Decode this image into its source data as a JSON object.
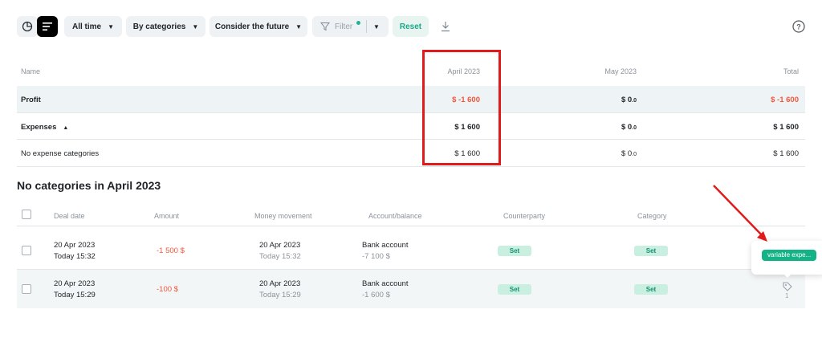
{
  "toolbar": {
    "period": "All time",
    "grouping": "By categories",
    "future": "Consider the future",
    "filter": "Filter",
    "reset": "Reset"
  },
  "summary": {
    "headers": {
      "name": "Name",
      "april": "April 2023",
      "may": "May 2023",
      "total": "Total"
    },
    "profit": {
      "label": "Profit",
      "april": "$ -1 600",
      "may_main": "$ 0",
      "may_dec": ".0",
      "total": "$ -1 600"
    },
    "expenses": {
      "label": "Expenses",
      "april": "$ 1 600",
      "may_main": "$ 0",
      "may_dec": ".0",
      "total": "$ 1 600"
    },
    "no_categories": {
      "label": "No expense categories",
      "april": "$ 1 600",
      "may_main": "$ 0",
      "may_dec": ".0",
      "total": "$ 1 600"
    }
  },
  "section_title": "No categories in April 2023",
  "transactions": {
    "headers": {
      "date": "Deal date",
      "amount": "Amount",
      "movement": "Money movement",
      "account": "Account/balance",
      "counterparty": "Counterparty",
      "category": "Category"
    },
    "rows": [
      {
        "date": "20 Apr 2023",
        "time": "Today 15:32",
        "amount": "-1 500  $",
        "move_date": "20 Apr 2023",
        "move_time": "Today 15:32",
        "account": "Bank account",
        "balance": "-7 100  $",
        "counterparty": "Set",
        "category": "Set"
      },
      {
        "date": "20 Apr 2023",
        "time": "Today 15:29",
        "amount": "-100  $",
        "move_date": "20 Apr 2023",
        "move_time": "Today 15:29",
        "account": "Bank account",
        "balance": "-1 600  $",
        "counterparty": "Set",
        "category": "Set"
      }
    ],
    "tag_count": "1",
    "tooltip_tag": "variable expe..."
  },
  "colors": {
    "negative": "#f2553a",
    "accent": "#14b387",
    "annotation": "#e11b1b"
  }
}
